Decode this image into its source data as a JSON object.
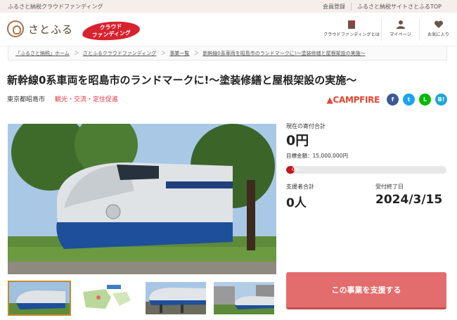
{
  "topbar": {
    "tagline": "ふるさと納税クラウドファンディング",
    "links": [
      "会員登録",
      "ふるさと納税サイトさとふるTOP"
    ]
  },
  "header": {
    "logo_text": "さとふる",
    "badge_line1": "クラウド",
    "badge_line2": "ファンディング",
    "icons": [
      {
        "icon": "book-icon",
        "label": "クラウドファンディングとは"
      },
      {
        "icon": "user-icon",
        "label": "マイページ"
      },
      {
        "icon": "heart-icon",
        "label": "お気に入り"
      }
    ]
  },
  "breadcrumb": [
    "「ふるさと納税」ホーム",
    "さとふるクラウドファンディング",
    "事業一覧",
    "新幹線0系車両を昭島市のランドマークに!～塗装修繕と屋根架設の実施～"
  ],
  "project": {
    "title": "新幹線0系車両を昭島市のランドマークに!～塗装修繕と屋根架設の実施～",
    "location": "東京都昭島市",
    "tags": "観光・交流・定住促進"
  },
  "share": {
    "campfire": "CAMPFIRE",
    "facebook": "f",
    "twitter": "t",
    "line": "L",
    "hatena": "B!"
  },
  "stats": {
    "current_label": "現在の寄付合計",
    "current_value": "0円",
    "goal": "目標金額：15,000,000円",
    "percent_text": "0%",
    "progress_fraction": 0.0,
    "supporters_label": "支援者合計",
    "supporters_value": "0人",
    "deadline_label": "受付終了日",
    "deadline_value": "2024/3/15"
  },
  "support_button": "この事業を支援する",
  "colors": {
    "accent": "#d7232f",
    "button": "#e36c6c",
    "topbar": "#f6eeea"
  }
}
